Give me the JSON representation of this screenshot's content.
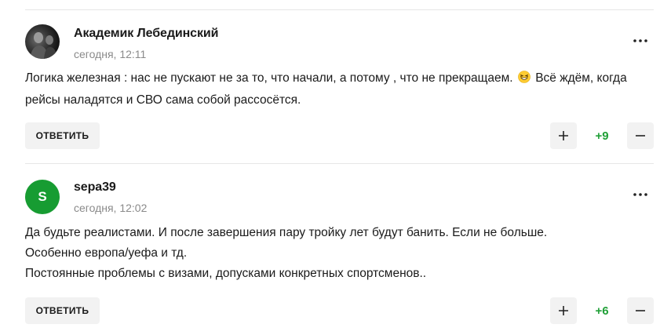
{
  "colors": {
    "positive_score": "#21a038",
    "avatar_green": "#179c32",
    "button_bg": "#f2f2f2",
    "muted_text": "#8a8a8a"
  },
  "comments": [
    {
      "author": "Академик Лебединский",
      "time": "сегодня, 12:11",
      "avatar_type": "photo",
      "text_before_emoji": "Логика железная : нас не пускают не за то, что начали, а потому , что не прекращаем.",
      "emoji": "grinning-squinting-face-icon",
      "text_after_emoji": "Всё ждём, когда рейсы наладятся и СВО сама собой рассосётся.",
      "reply_label": "ОТВЕТИТЬ",
      "score": "+9"
    },
    {
      "author": "sepa39",
      "time": "сегодня, 12:02",
      "avatar_type": "letter",
      "avatar_letter": "S",
      "lines": [
        "Да будьте реалистами. И после завершения пару тройку лет будут банить. Если не больше.",
        "Особенно европа/уефа и тд.",
        "Постоянные проблемы с визами, допусками конкретных спортсменов.."
      ],
      "reply_label": "ОТВЕТИТЬ",
      "score": "+6"
    }
  ]
}
